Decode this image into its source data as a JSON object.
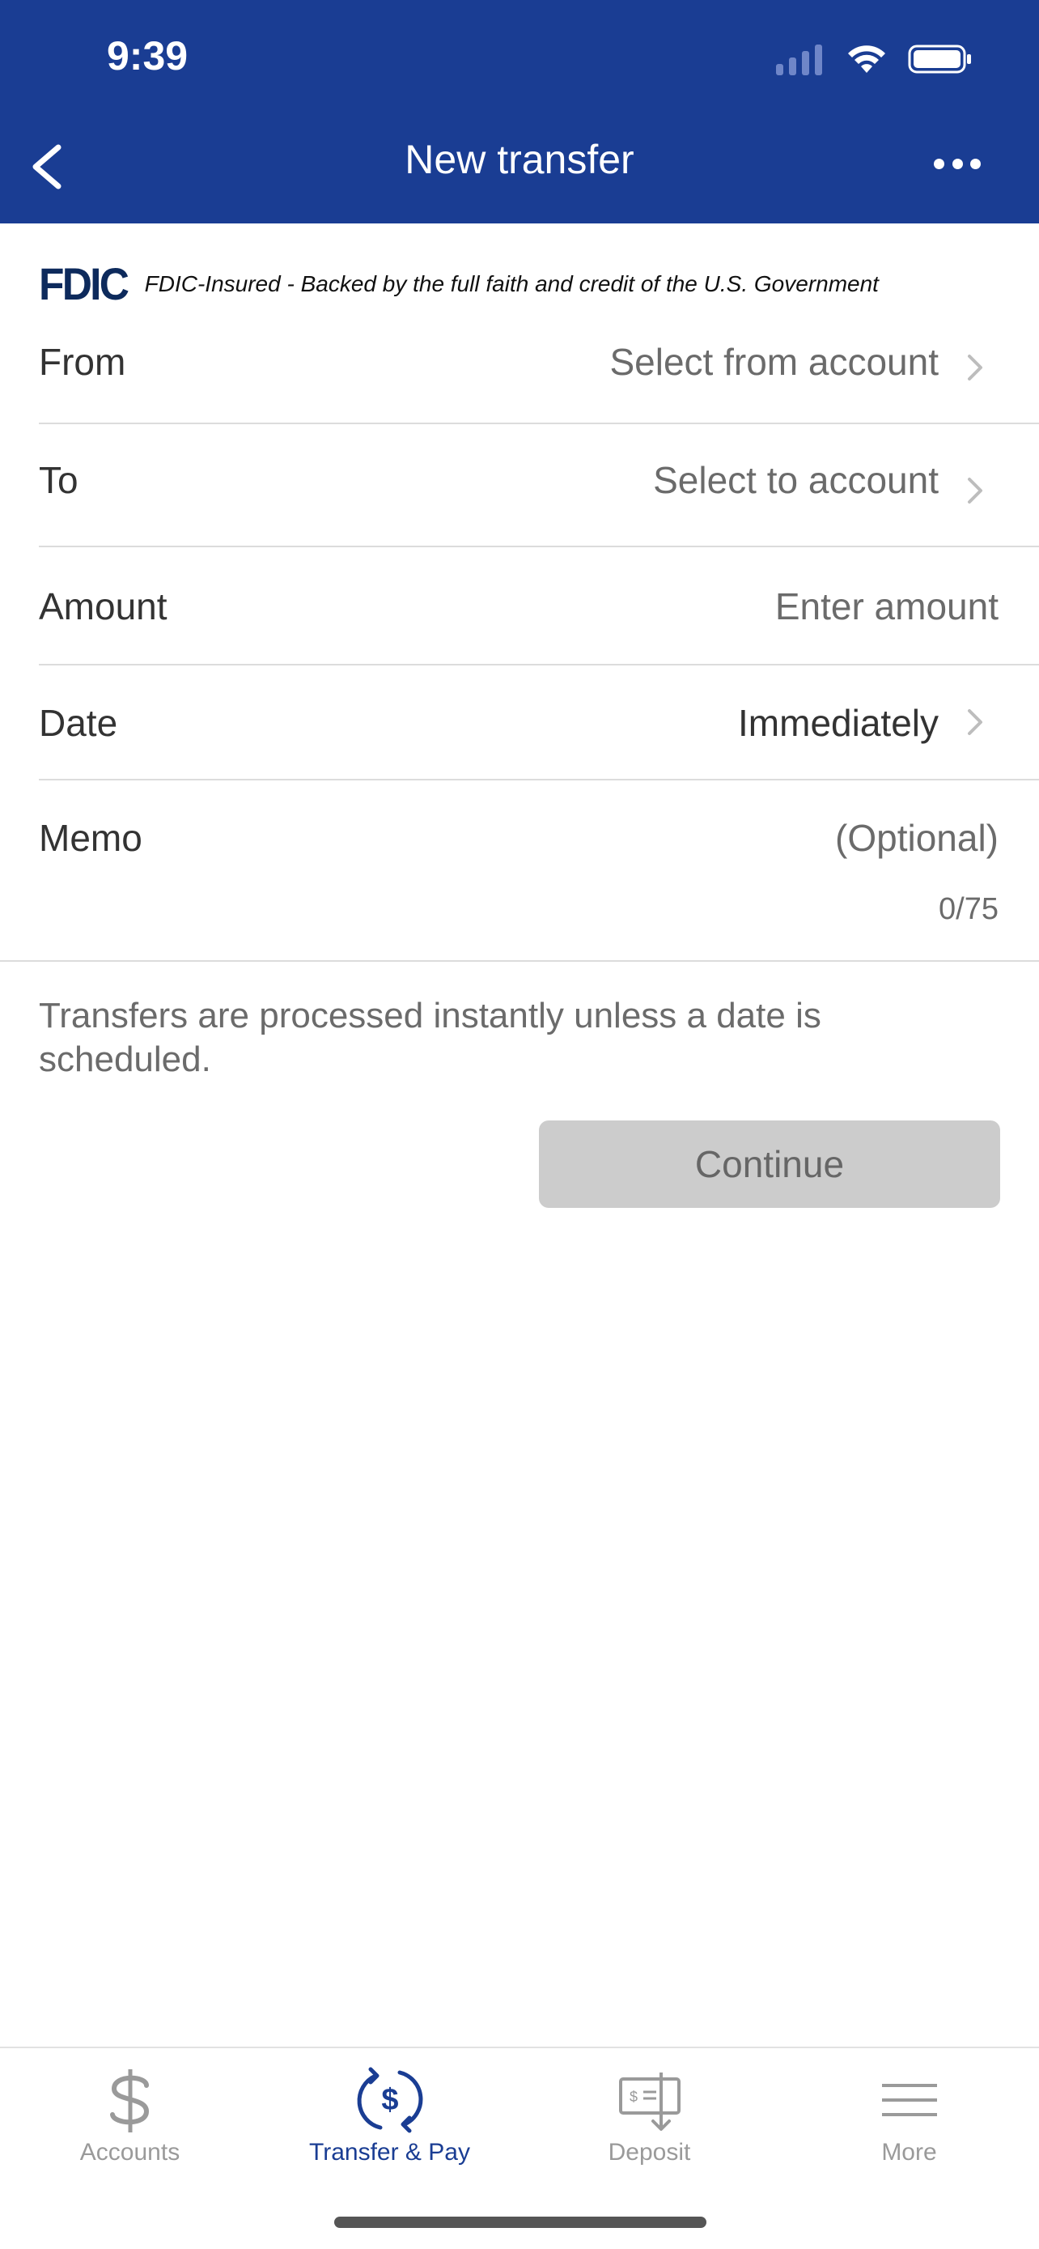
{
  "status_bar": {
    "time": "9:39"
  },
  "header": {
    "title": "New transfer"
  },
  "fdic": {
    "logo": "FDIC",
    "text": "FDIC-Insured - Backed by the full faith and credit of the U.S. Government"
  },
  "form": {
    "from": {
      "label": "From",
      "value": "Select from account"
    },
    "to": {
      "label": "To",
      "value": "Select to account"
    },
    "amount": {
      "label": "Amount",
      "placeholder": "Enter amount"
    },
    "date": {
      "label": "Date",
      "value": "Immediately"
    },
    "memo": {
      "label": "Memo",
      "placeholder": "(Optional)",
      "counter": "0/75"
    }
  },
  "note": "Transfers are processed instantly unless a date is scheduled.",
  "continue_label": "Continue",
  "tabs": [
    {
      "label": "Accounts",
      "icon": "dollar-icon",
      "active": false
    },
    {
      "label": "Transfer & Pay",
      "icon": "transfer-pay-icon",
      "active": true
    },
    {
      "label": "Deposit",
      "icon": "check-deposit-icon",
      "active": false
    },
    {
      "label": "More",
      "icon": "menu-icon",
      "active": false
    }
  ],
  "colors": {
    "brand": "#1a3d93",
    "disabled_button": "#cccccc",
    "inactive_tab": "#9a9a9a"
  }
}
